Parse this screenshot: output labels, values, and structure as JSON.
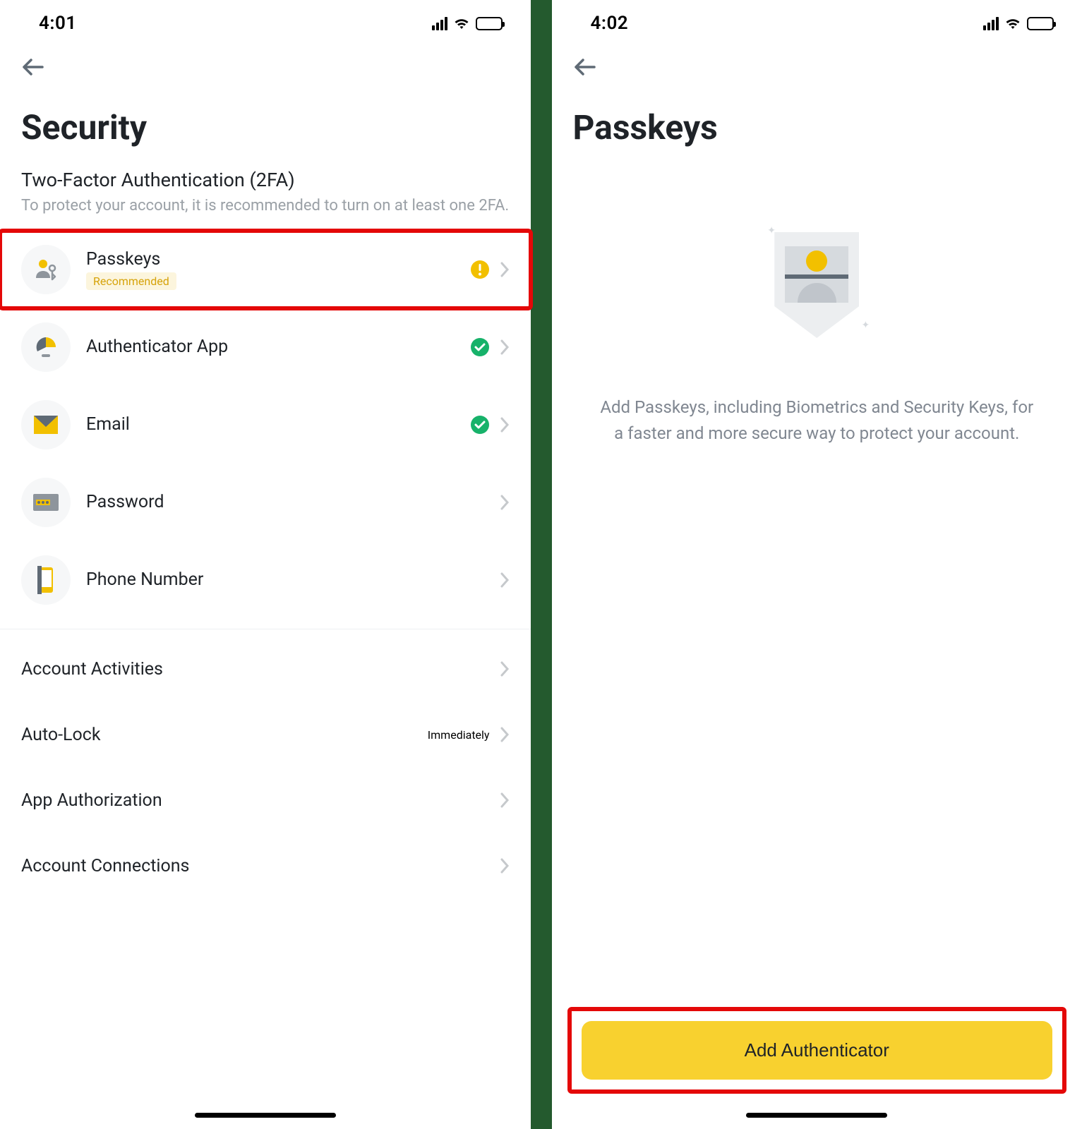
{
  "left": {
    "time": "4:01",
    "title": "Security",
    "twofa": {
      "heading": "Two-Factor Authentication (2FA)",
      "desc": "To protect your account, it is recommended to turn on at least one 2FA."
    },
    "items": {
      "passkeys": {
        "label": "Passkeys",
        "badge": "Recommended"
      },
      "authapp": {
        "label": "Authenticator App"
      },
      "email": {
        "label": "Email"
      },
      "password": {
        "label": "Password"
      },
      "phone": {
        "label": "Phone Number"
      }
    },
    "more": {
      "activities": "Account Activities",
      "autolock": {
        "label": "Auto-Lock",
        "value": "Immediately"
      },
      "appauth": "App Authorization",
      "connections": "Account Connections"
    }
  },
  "right": {
    "time": "4:02",
    "title": "Passkeys",
    "desc": "Add Passkeys, including Biometrics and Security Keys, for a faster and more secure way to protect your account.",
    "cta": "Add Authenticator"
  }
}
